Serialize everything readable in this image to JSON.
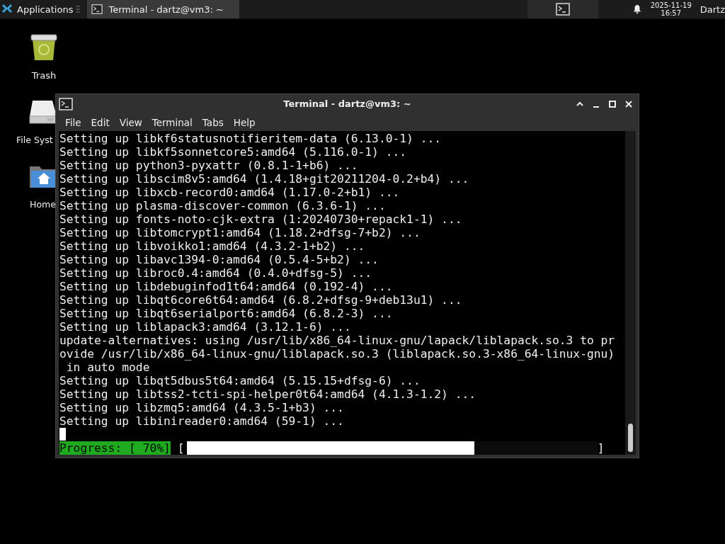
{
  "panel": {
    "menu_label": "Applications",
    "task": {
      "title": "Terminal - dartz@vm3: ~",
      "selected": true
    },
    "clock_date": "2025-11-19",
    "clock_time": "16:57",
    "user": "Dartz"
  },
  "desktop_icons": [
    {
      "label": "Trash",
      "kind": "trash"
    },
    {
      "label": "File Syst",
      "kind": "drive"
    },
    {
      "label": "Home",
      "kind": "home"
    }
  ],
  "window": {
    "title": "Terminal - dartz@vm3: ~",
    "menu": [
      "File",
      "Edit",
      "View",
      "Terminal",
      "Tabs",
      "Help"
    ],
    "lines": [
      "Setting up libkf6statusnotifieritem-data (6.13.0-1) ...",
      "Setting up libkf5sonnetcore5:amd64 (5.116.0-1) ...",
      "Setting up python3-pyxattr (0.8.1-1+b6) ...",
      "Setting up libscim8v5:amd64 (1.4.18+git20211204-0.2+b4) ...",
      "Setting up libxcb-record0:amd64 (1.17.0-2+b1) ...",
      "Setting up plasma-discover-common (6.3.6-1) ...",
      "Setting up fonts-noto-cjk-extra (1:20240730+repack1-1) ...",
      "Setting up libtomcrypt1:amd64 (1.18.2+dfsg-7+b2) ...",
      "Setting up libvoikko1:amd64 (4.3.2-1+b2) ...",
      "Setting up libavc1394-0:amd64 (0.5.4-5+b2) ...",
      "Setting up libroc0.4:amd64 (0.4.0+dfsg-5) ...",
      "Setting up libdebuginfod1t64:amd64 (0.192-4) ...",
      "Setting up libqt6core6t64:amd64 (6.8.2+dfsg-9+deb13u1) ...",
      "Setting up libqt6serialport6:amd64 (6.8.2-3) ...",
      "Setting up liblapack3:amd64 (3.12.1-6) ...",
      "update-alternatives: using /usr/lib/x86_64-linux-gnu/lapack/liblapack.so.3 to pr",
      "ovide /usr/lib/x86_64-linux-gnu/liblapack.so.3 (liblapack.so.3-x86_64-linux-gnu)",
      " in auto mode",
      "Setting up libqt5dbus5t64:amd64 (5.15.15+dfsg-6) ...",
      "Setting up libtss2-tcti-spi-helper0t64:amd64 (4.1.3-1.2) ...",
      "Setting up libzmq5:amd64 (4.3.5-1+b3) ...",
      "Setting up libinireader0:amd64 (59-1) ..."
    ],
    "progress": {
      "label": "Progress: [ 70%]",
      "open": "[",
      "close": "]",
      "level": 0.7
    }
  }
}
